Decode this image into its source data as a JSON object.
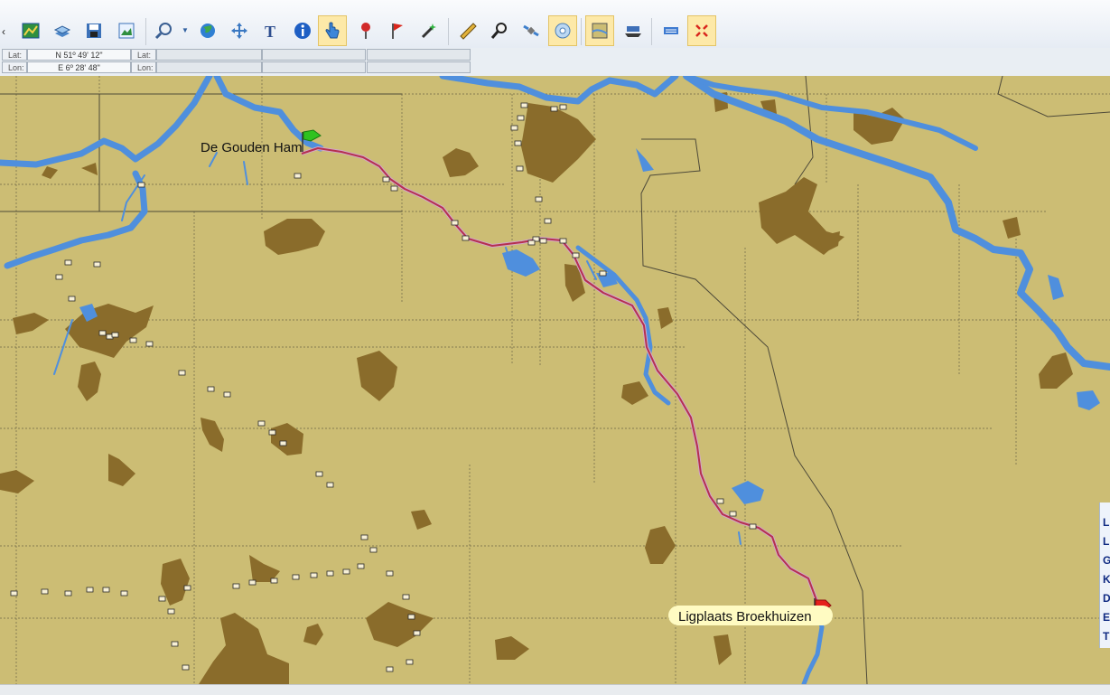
{
  "toolbar": {
    "scroll_left_label": "‹",
    "more_label": "››",
    "buttons": [
      {
        "name": "chart-icon"
      },
      {
        "name": "layers-icon"
      },
      {
        "name": "save-chart-icon"
      },
      {
        "name": "image-icon"
      },
      {
        "name": "zoom-icon"
      },
      {
        "name": "globe-icon"
      },
      {
        "name": "pan-icon"
      },
      {
        "name": "text-tool-icon"
      },
      {
        "name": "info-icon"
      },
      {
        "name": "hand-pointer-icon"
      },
      {
        "name": "pushpin-icon"
      },
      {
        "name": "route-flag-icon"
      },
      {
        "name": "magic-wand-icon"
      },
      {
        "name": "measure-tool-icon"
      },
      {
        "name": "search-icon"
      },
      {
        "name": "satellite-icon"
      },
      {
        "name": "compass-icon"
      },
      {
        "name": "map-settings-icon"
      },
      {
        "name": "ship-icon"
      },
      {
        "name": "keyboard-icon"
      },
      {
        "name": "expand-icon"
      }
    ]
  },
  "coords": {
    "lat_label": "Lat:",
    "lon_label": "Lon:",
    "lat_value": "N 51º 49' 12\"",
    "lon_value": "E 6º 28' 48\""
  },
  "map": {
    "colors": {
      "land": "#ccbd74",
      "urban": "#8a6c2b",
      "water": "#4f8fdd",
      "route": "#b5304f",
      "grid": "#6b6446",
      "start_flag": "#2fc21f",
      "end_flag": "#e5201c",
      "label_highlight": "#fffbc2"
    },
    "start_label": "De Gouden Ham",
    "end_label": "Ligplaats Broekhuizen"
  },
  "side_panel": {
    "letters": [
      "L",
      "L",
      "G",
      "K",
      "D",
      "E",
      "T"
    ]
  }
}
